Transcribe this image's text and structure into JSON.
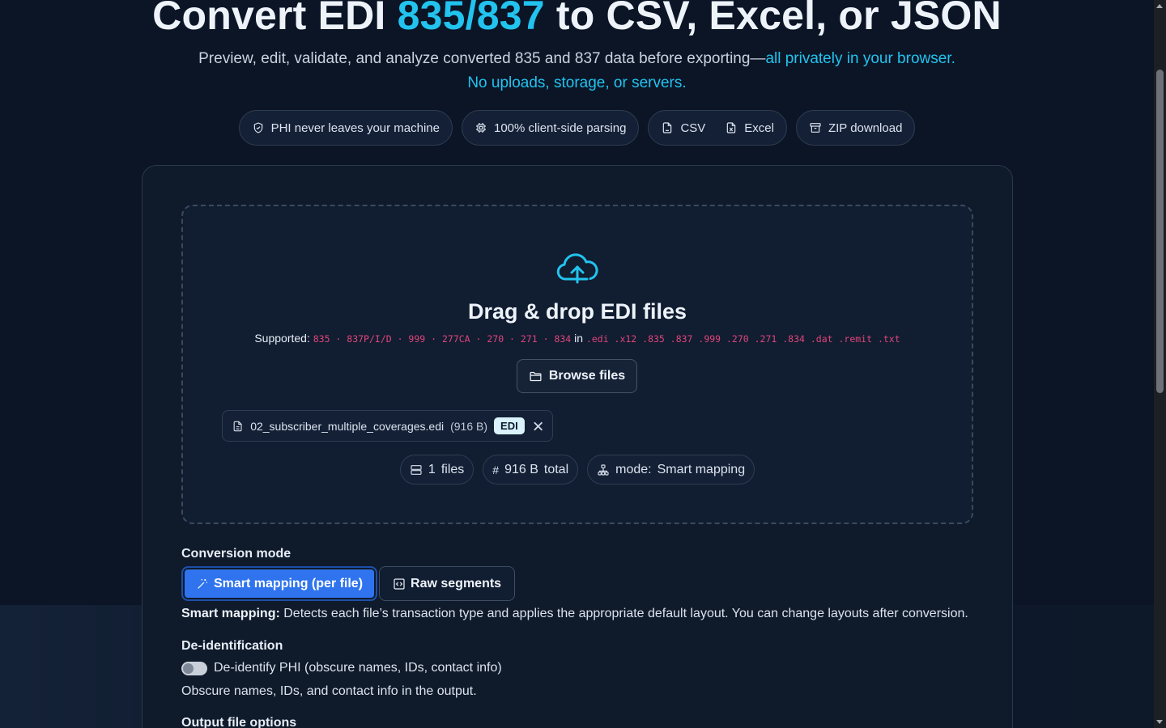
{
  "hero": {
    "title_pre": "Convert EDI ",
    "title_accent": "835/837",
    "title_post": " to CSV, Excel, or JSON",
    "subtitle_plain": "Preview, edit, validate, and analyze converted 835 and 837 data before exporting—",
    "subtitle_highlight_1": "all privately in your browser.",
    "subtitle_highlight_2": "No uploads, storage, or servers."
  },
  "pills": [
    {
      "icon": "shield-icon",
      "label": "PHI never leaves your machine"
    },
    {
      "icon": "chip-icon",
      "label": "100% client-side parsing"
    },
    {
      "icon": "csv-file-icon",
      "label": "CSV"
    },
    {
      "icon": "excel-file-icon",
      "label": "Excel"
    },
    {
      "icon": "archive-icon",
      "label": "ZIP download"
    }
  ],
  "dropzone": {
    "icon": "cloud-upload-icon",
    "title": "Drag & drop EDI files",
    "supported_label": "Supported:",
    "transaction_types": "835 · 837P/I/D · 999 · 277CA · 270 · 271 · 834",
    "in_word": "in",
    "extensions": ".edi .x12 .835 .837 .999 .270 .271 .834 .dat .remit .txt",
    "browse_label": "Browse files"
  },
  "file": {
    "name": "02_subscriber_multiple_coverages.edi",
    "size": "(916 B)",
    "badge": "EDI"
  },
  "stats": {
    "files_count": "1",
    "files_label": "files",
    "total_size": "916 B",
    "total_label": "total",
    "mode_label": "mode:",
    "mode_value": "Smart mapping"
  },
  "conversion": {
    "heading": "Conversion mode",
    "smart_label": "Smart mapping (per file)",
    "raw_label": "Raw segments",
    "desc_bold": "Smart mapping:",
    "desc_text": " Detects each file’s transaction type and applies the appropriate default layout. You can change layouts after conversion."
  },
  "deid": {
    "heading": "De-identification",
    "toggle_label": "De-identify PHI (obscure names, IDs, contact info)",
    "toggle_on": false,
    "desc": "Obscure names, IDs, and contact info in the output."
  },
  "output": {
    "heading": "Output file options"
  },
  "colors": {
    "accent": "#22c3ee",
    "primary_button": "#2f74ee",
    "code_text": "#e0457b",
    "background": "#0b1526"
  }
}
